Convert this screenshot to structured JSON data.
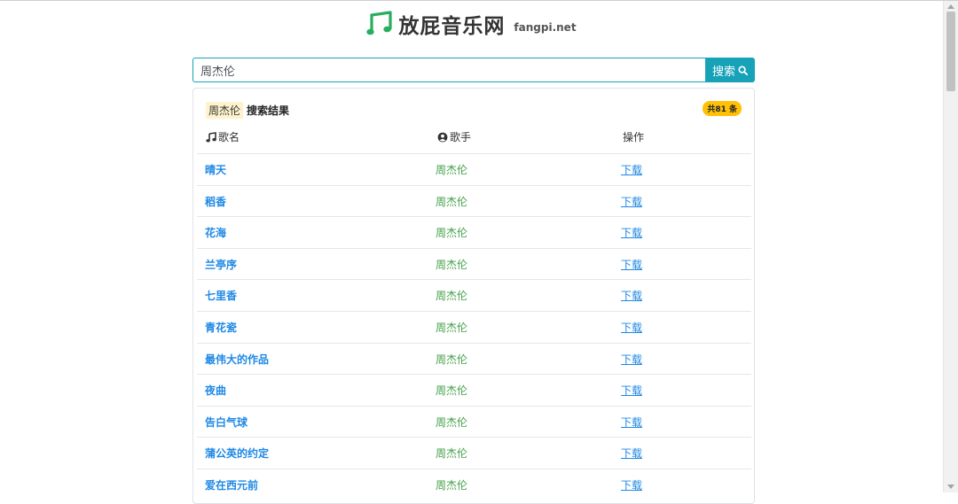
{
  "site": {
    "brand": "放屁音乐网",
    "domain": "fangpi.net"
  },
  "search": {
    "value": "周杰伦",
    "button_label": "搜索"
  },
  "results": {
    "keyword": "周杰伦",
    "title": "搜索结果",
    "count_badge": "共81 条",
    "headers": {
      "song": "歌名",
      "singer": "歌手",
      "action": "操作"
    },
    "rows": [
      {
        "title": "晴天",
        "singer": "周杰伦",
        "action": "下载"
      },
      {
        "title": "稻香",
        "singer": "周杰伦",
        "action": "下载"
      },
      {
        "title": "花海",
        "singer": "周杰伦",
        "action": "下载"
      },
      {
        "title": "兰亭序",
        "singer": "周杰伦",
        "action": "下载"
      },
      {
        "title": "七里香",
        "singer": "周杰伦",
        "action": "下载"
      },
      {
        "title": "青花瓷",
        "singer": "周杰伦",
        "action": "下载"
      },
      {
        "title": "最伟大的作品",
        "singer": "周杰伦",
        "action": "下载"
      },
      {
        "title": "夜曲",
        "singer": "周杰伦",
        "action": "下载"
      },
      {
        "title": "告白气球",
        "singer": "周杰伦",
        "action": "下载"
      },
      {
        "title": "蒲公英的约定",
        "singer": "周杰伦",
        "action": "下载"
      },
      {
        "title": "爱在西元前",
        "singer": "周杰伦",
        "action": "下载"
      }
    ]
  },
  "colors": {
    "accent": "#17a2b8",
    "badge": "#ffc107",
    "title_link": "#1e88e5",
    "singer": "#43a047",
    "logo": "#27ae60"
  },
  "icons": {
    "logo": "music-notes-icon",
    "search": "search-icon",
    "song": "music-note-icon",
    "singer": "user-circle-icon"
  }
}
